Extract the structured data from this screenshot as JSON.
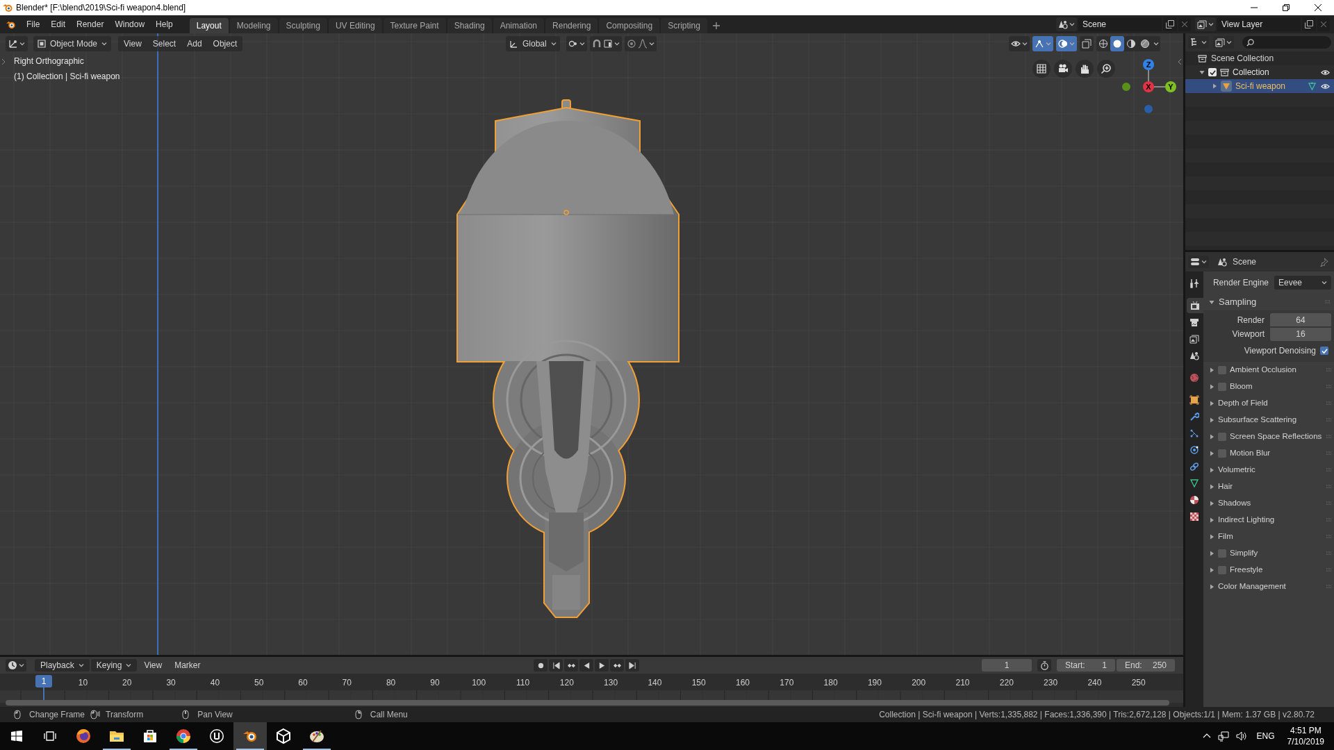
{
  "title_bar": {
    "title": "Blender* [F:\\blend\\2019\\Sci-fi weapon4.blend]"
  },
  "menu": [
    "File",
    "Edit",
    "Render",
    "Window",
    "Help"
  ],
  "workspaces": [
    {
      "label": "Layout",
      "selected": true
    },
    {
      "label": "Modeling",
      "selected": false
    },
    {
      "label": "Sculpting",
      "selected": false
    },
    {
      "label": "UV Editing",
      "selected": false
    },
    {
      "label": "Texture Paint",
      "selected": false
    },
    {
      "label": "Shading",
      "selected": false
    },
    {
      "label": "Animation",
      "selected": false
    },
    {
      "label": "Rendering",
      "selected": false
    },
    {
      "label": "Compositing",
      "selected": false
    },
    {
      "label": "Scripting",
      "selected": false
    }
  ],
  "scene": "Scene",
  "view_layer": "View Layer",
  "viewport": {
    "mode": "Object Mode",
    "menus": [
      "View",
      "Select",
      "Add",
      "Object"
    ],
    "orientation": "Global",
    "view_name": "Right Orthographic",
    "collection_info": "(1) Collection | Sci-fi weapon",
    "gizmo_axes": [
      {
        "label": "Z",
        "color": "#2f83e6"
      },
      {
        "label": "X",
        "color": "#e13345"
      },
      {
        "label": "Y",
        "color": "#7fbf22"
      }
    ]
  },
  "outliner": {
    "root": "Scene Collection",
    "items": [
      {
        "label": "Collection",
        "checked": true,
        "expanded": true,
        "selected": false,
        "children": [
          {
            "label": "Sci-fi weapon",
            "expanded": false,
            "selected": true
          }
        ]
      }
    ]
  },
  "properties": {
    "context": "Scene",
    "tabs": [
      {
        "kind": "tool",
        "selected": false
      },
      {
        "kind": "render",
        "selected": true
      },
      {
        "kind": "output",
        "selected": false
      },
      {
        "kind": "view_layer",
        "selected": false
      },
      {
        "kind": "scene",
        "selected": false
      },
      {
        "kind": "world",
        "selected": false
      },
      {
        "kind": "object",
        "selected": false
      },
      {
        "kind": "modifiers",
        "selected": false
      },
      {
        "kind": "particles",
        "selected": false
      },
      {
        "kind": "physics",
        "selected": false
      },
      {
        "kind": "constraints",
        "selected": false
      },
      {
        "kind": "data",
        "selected": false
      },
      {
        "kind": "material",
        "selected": false
      },
      {
        "kind": "texture",
        "selected": false
      }
    ],
    "render_engine_label": "Render Engine",
    "render_engine": "Eevee",
    "sampling": {
      "label": "Sampling",
      "expanded": true,
      "fields": [
        {
          "label": "Render",
          "value": "64"
        },
        {
          "label": "Viewport",
          "value": "16"
        }
      ],
      "denoising": {
        "label": "Viewport Denoising",
        "checked": true
      }
    },
    "panels": [
      {
        "label": "Ambient Occlusion",
        "kind": "toggle",
        "checked": false,
        "expanded": false
      },
      {
        "label": "Bloom",
        "kind": "toggle",
        "checked": false,
        "expanded": false
      },
      {
        "label": "Depth of Field",
        "kind": "plain",
        "expanded": false
      },
      {
        "label": "Subsurface Scattering",
        "kind": "plain",
        "expanded": false
      },
      {
        "label": "Screen Space Reflections",
        "kind": "toggle",
        "checked": false,
        "expanded": false
      },
      {
        "label": "Motion Blur",
        "kind": "toggle",
        "checked": false,
        "expanded": false
      },
      {
        "label": "Volumetric",
        "kind": "plain",
        "expanded": false
      },
      {
        "label": "Hair",
        "kind": "plain",
        "expanded": false
      },
      {
        "label": "Shadows",
        "kind": "plain",
        "expanded": false
      },
      {
        "label": "Indirect Lighting",
        "kind": "plain",
        "expanded": false
      },
      {
        "label": "Film",
        "kind": "plain",
        "expanded": false
      },
      {
        "label": "Simplify",
        "kind": "toggle",
        "checked": false,
        "expanded": false
      },
      {
        "label": "Freestyle",
        "kind": "toggle",
        "checked": false,
        "expanded": false
      },
      {
        "label": "Color Management",
        "kind": "plain",
        "expanded": false
      }
    ]
  },
  "timeline": {
    "menus": [
      {
        "label": "Playback",
        "dropdown": true
      },
      {
        "label": "Keying",
        "dropdown": true
      },
      {
        "label": "View",
        "dropdown": false
      },
      {
        "label": "Marker",
        "dropdown": false
      }
    ],
    "current_frame": "1",
    "start_label": "Start:",
    "start": "1",
    "end_label": "End:",
    "end": "250",
    "playhead": "1",
    "ruler": [
      "10",
      "20",
      "30",
      "40",
      "50",
      "60",
      "70",
      "80",
      "90",
      "100",
      "110",
      "120",
      "130",
      "140",
      "150",
      "160",
      "170",
      "180",
      "190",
      "200",
      "210",
      "220",
      "230",
      "240",
      "250"
    ]
  },
  "status_bar": {
    "hints": [
      {
        "label": "Change Frame",
        "kind": "left"
      },
      {
        "label": "Transform",
        "kind": "drag"
      },
      {
        "label": "Pan View",
        "kind": "middle"
      },
      {
        "label": "Call Menu",
        "kind": "right"
      }
    ],
    "stats": "Collection | Sci-fi weapon | Verts:1,335,882 | Faces:1,336,390 | Tris:2,672,128 | Objects:1/1 | Mem: 1.37 GB | v2.80.72"
  },
  "taskbar": {
    "apps": [
      {
        "kind": "firefox",
        "running": false,
        "selected": false
      },
      {
        "kind": "explorer",
        "running": true,
        "selected": false
      },
      {
        "kind": "store",
        "running": false,
        "selected": false
      },
      {
        "kind": "chrome",
        "running": true,
        "selected": false
      },
      {
        "kind": "unreal",
        "running": false,
        "selected": false
      },
      {
        "kind": "blender",
        "running": true,
        "selected": true
      },
      {
        "kind": "unity",
        "running": false,
        "selected": false
      },
      {
        "kind": "paint",
        "running": true,
        "selected": false
      }
    ],
    "language": "ENG",
    "time": "4:51 PM",
    "date": "7/10/2019"
  }
}
